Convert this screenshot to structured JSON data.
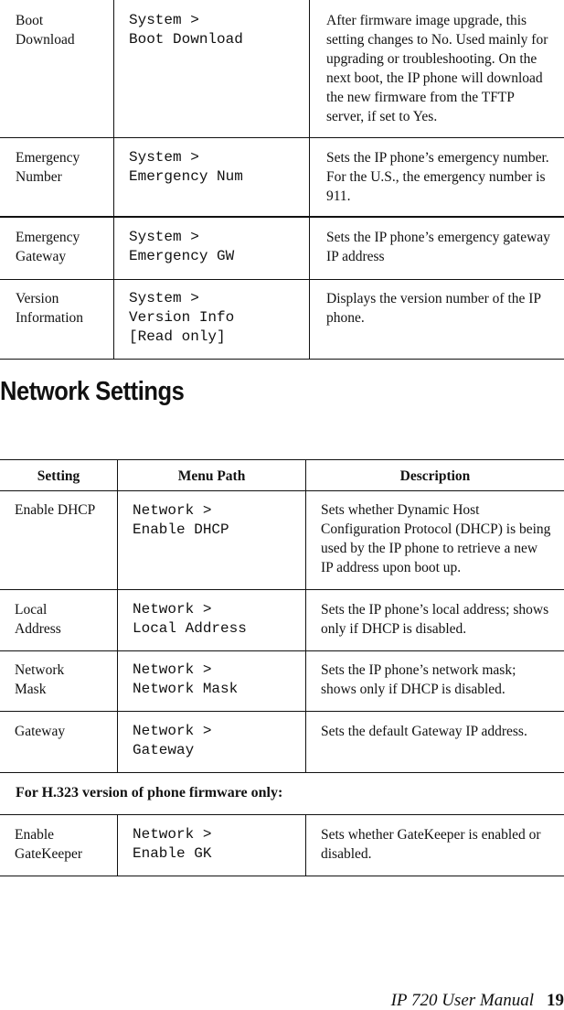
{
  "system_table": {
    "rows": [
      {
        "setting": "Boot\nDownload",
        "path": "System >\nBoot Download",
        "description": "After firmware image upgrade, this setting changes to No. Used mainly for upgrading or troubleshooting. On the next boot, the IP phone will download the new firmware from the TFTP server, if set to Yes."
      },
      {
        "setting": "Emergency\nNumber",
        "path": "System >\nEmergency Num",
        "description": "Sets the IP phone’s emergency number. For the U.S., the emergency number is 911."
      },
      {
        "setting": "Emergency\nGateway",
        "path": "System >\nEmergency GW",
        "description": "Sets the IP phone’s emergency gateway IP address"
      },
      {
        "setting": "Version\nInformation",
        "path": "System >\nVersion Info\n[Read only]",
        "description": "Displays the version number of the IP phone."
      }
    ]
  },
  "section_title": "Network Settings",
  "network_table": {
    "headers": {
      "setting": "Setting",
      "path": "Menu Path",
      "description": "Description"
    },
    "rows": [
      {
        "setting": "Enable DHCP",
        "path": "Network >\nEnable DHCP",
        "description": "Sets whether Dynamic Host Configuration Protocol (DHCP) is being used by the IP phone to retrieve a new IP address upon boot up."
      },
      {
        "setting": "Local\nAddress",
        "path": "Network >\nLocal Address",
        "description": "Sets the IP phone’s local address; shows only if DHCP is disabled."
      },
      {
        "setting": "Network\nMask",
        "path": "Network >\nNetwork Mask",
        "description": "Sets the IP phone’s network mask; shows only if DHCP is disabled."
      },
      {
        "setting": "Gateway",
        "path": "Network >\nGateway",
        "description": "Sets the default Gateway IP address."
      }
    ],
    "note": "For H.323 version of phone firmware only:",
    "h323_rows": [
      {
        "setting": "Enable\nGateKeeper",
        "path": "Network >\nEnable GK",
        "description": "Sets whether GateKeeper is enabled or disabled."
      }
    ]
  },
  "footer": {
    "manual": "IP 720 User Manual",
    "page": "19"
  }
}
